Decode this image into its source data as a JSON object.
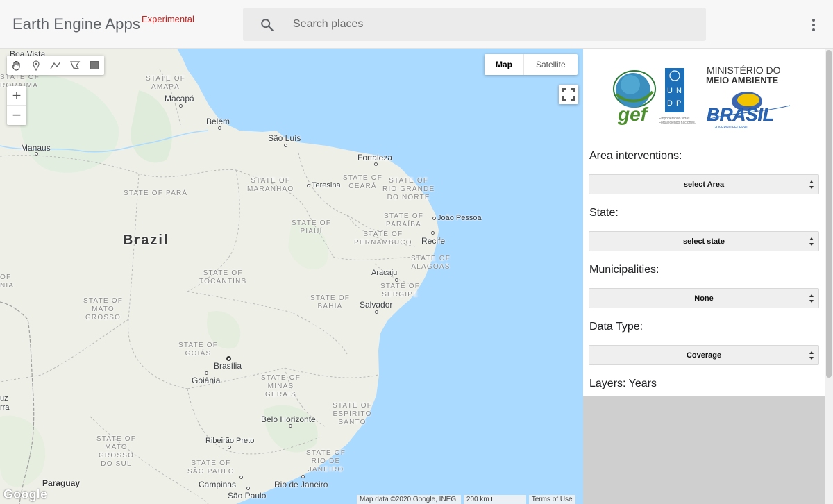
{
  "header": {
    "title": "Earth Engine Apps",
    "badge": "Experimental",
    "search_placeholder": "Search places",
    "menu_icon": "more-vert-icon"
  },
  "map": {
    "map_type_options": [
      "Map",
      "Satellite"
    ],
    "map_type_selected": "Map",
    "zoom_in_label": "+",
    "zoom_out_label": "−",
    "drawing_tools": [
      "hand-icon",
      "marker-icon",
      "polyline-icon",
      "polygon-icon",
      "rectangle-icon"
    ],
    "google_logo": "Google",
    "attribution": "Map data ©2020 Google, INEGI",
    "scale": "200 km",
    "terms": "Terms of Use",
    "country": "Brazil",
    "states": [
      "STATE OF\nAMAPÁ",
      "STATE OF PARÁ",
      "STATE OF\nMARANHÃO",
      "STATE OF\nCEARÁ",
      "STATE OF\nRIO GRANDE\nDO NORTE",
      "STATE OF\nPIAUÍ",
      "STATE OF\nPARAÍBA",
      "STATE OF\nPERNAMBUCO",
      "STATE OF\nALAGOAS",
      "STATE OF\nSERGIPE",
      "STATE OF\nTOCANTINS",
      "STATE OF\nBAHIA",
      "STATE OF\nMATO\nGROSSO",
      "STATE OF\nGOIÁS",
      "STATE OF\nMINAS\nGERAIS",
      "STATE OF\nESPÍRITO\nSANTO",
      "STATE OF\nRIO DE\nJANEIRO",
      "STATE OF\nMATO\nGROSSO\nDO SUL",
      "STATE OF\nSÃO PAULO",
      "STATE OF\nRORAIMA"
    ],
    "cities": [
      "Boa Vista",
      "Macapá",
      "Belém",
      "São Luís",
      "Manaus",
      "Fortaleza",
      "Teresina",
      "João Pessoa",
      "Recife",
      "Aracaju",
      "Salvador",
      "Brasília",
      "Goiânia",
      "Belo Horizonte",
      "Ribeirão Preto",
      "Rio de Janeiro",
      "Campinas",
      "São Paulo",
      "Paraguay"
    ],
    "edge_labels": [
      "OF\nNIA",
      "uz\nrra"
    ]
  },
  "panel": {
    "logos": {
      "gef": "gef",
      "undp": [
        "U",
        "N",
        "D",
        "P"
      ],
      "undp_tagline": "Empoderando vidas.\nFortaleciendo naciones.",
      "ministry_line1": "MINISTÉRIO DO",
      "ministry_line2": "MEIO AMBIENTE",
      "brasil": "BRASIL",
      "brasil_sub": "GOVERNO FEDERAL"
    },
    "area_label": "Area interventions:",
    "area_value": "select Area",
    "state_label": "State:",
    "state_value": "select state",
    "municipalities_label": "Municipalities:",
    "municipalities_value": "None",
    "datatype_label": "Data Type:",
    "datatype_value": "Coverage",
    "layers_label": "Layers: Years"
  },
  "colors": {
    "ocean": "#aadaff",
    "land": "#eef0e8",
    "badge": "#c5221f",
    "select_bg": "#efefef"
  }
}
